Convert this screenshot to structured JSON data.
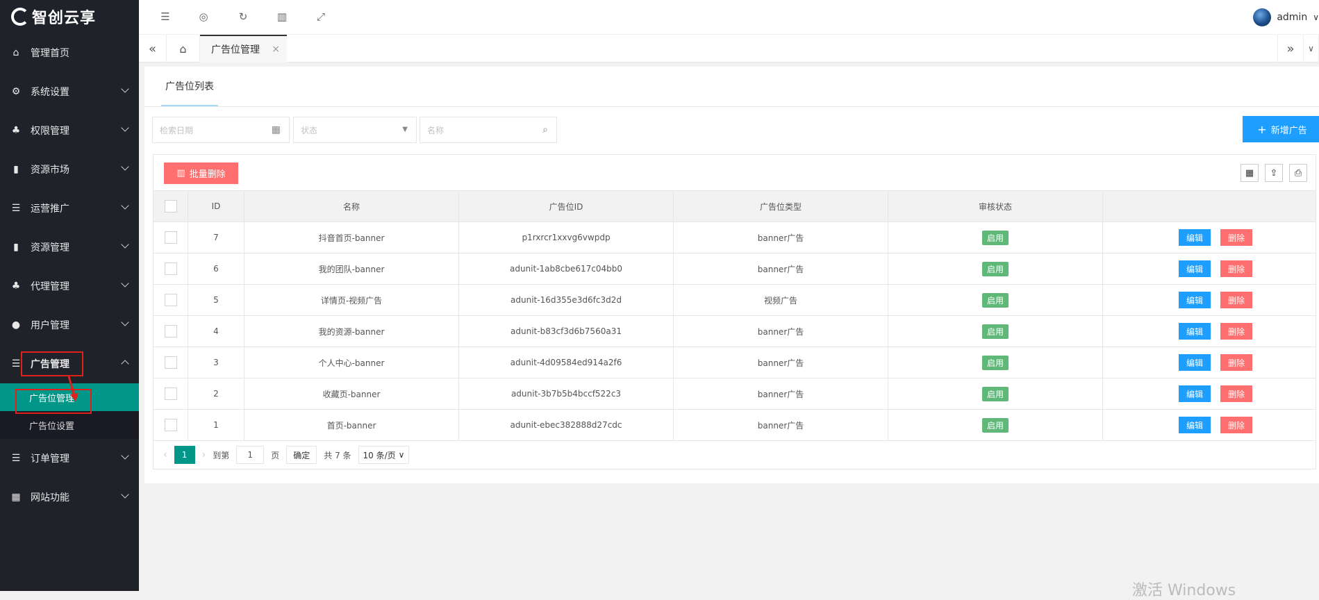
{
  "brand": {
    "logo_text": "智创云享"
  },
  "sidebar": {
    "items": [
      {
        "label": "管理首页",
        "icon": "home-icon",
        "glyph": "⌂"
      },
      {
        "label": "系统设置",
        "icon": "gear-icon",
        "glyph": "⚙"
      },
      {
        "label": "权限管理",
        "icon": "users-icon",
        "glyph": "♣"
      },
      {
        "label": "资源市场",
        "icon": "book-icon",
        "glyph": "▮"
      },
      {
        "label": "运营推广",
        "icon": "list-icon",
        "glyph": "☰"
      },
      {
        "label": "资源管理",
        "icon": "book-icon",
        "glyph": "▮"
      },
      {
        "label": "代理管理",
        "icon": "sitemap-icon",
        "glyph": "♣"
      },
      {
        "label": "用户管理",
        "icon": "user-icon",
        "glyph": "●"
      },
      {
        "label": "广告管理",
        "icon": "list-icon",
        "glyph": "☰"
      },
      {
        "label": "订单管理",
        "icon": "list-icon",
        "glyph": "☰"
      },
      {
        "label": "网站功能",
        "icon": "grid-icon",
        "glyph": "▦"
      }
    ],
    "sub_items": [
      {
        "label": "广告位管理"
      },
      {
        "label": "广告位设置"
      }
    ]
  },
  "topbar": {
    "icons": [
      "menu-collapse-icon",
      "globe-icon",
      "refresh-icon",
      "trash-icon",
      "fullscreen-icon"
    ],
    "username": "admin"
  },
  "tabs": {
    "active_label": "广告位管理",
    "close_glyph": "×"
  },
  "card": {
    "title": "广告位列表",
    "filters": {
      "date_placeholder": "检索日期",
      "status_placeholder": "状态",
      "name_placeholder": "名称"
    },
    "add_button": "新增广告",
    "batch_delete_button": "批量删除"
  },
  "table": {
    "columns": [
      "ID",
      "名称",
      "广告位ID",
      "广告位类型",
      "审核状态"
    ],
    "rows": [
      {
        "id": "7",
        "name": "抖音首页-banner",
        "ad_id": "p1rxrcr1xxvg6vwpdp",
        "type": "banner广告",
        "status": "启用"
      },
      {
        "id": "6",
        "name": "我的团队-banner",
        "ad_id": "adunit-1ab8cbe617c04bb0",
        "type": "banner广告",
        "status": "启用"
      },
      {
        "id": "5",
        "name": "详情页-视频广告",
        "ad_id": "adunit-16d355e3d6fc3d2d",
        "type": "视频广告",
        "status": "启用"
      },
      {
        "id": "4",
        "name": "我的资源-banner",
        "ad_id": "adunit-b83cf3d6b7560a31",
        "type": "banner广告",
        "status": "启用"
      },
      {
        "id": "3",
        "name": "个人中心-banner",
        "ad_id": "adunit-4d09584ed914a2f6",
        "type": "banner广告",
        "status": "启用"
      },
      {
        "id": "2",
        "name": "收藏页-banner",
        "ad_id": "adunit-3b7b5b4bccf522c3",
        "type": "banner广告",
        "status": "启用"
      },
      {
        "id": "1",
        "name": "首页-banner",
        "ad_id": "adunit-ebec382888d27cdc",
        "type": "banner广告",
        "status": "启用"
      }
    ],
    "edit_label": "编辑",
    "delete_label": "删除"
  },
  "pagination": {
    "current_page": "1",
    "goto_label": "到第",
    "goto_value": "1",
    "page_unit": "页",
    "confirm_label": "确定",
    "total_text": "共 7 条",
    "page_size": "10 条/页"
  },
  "watermark": "激活 Windows",
  "colors": {
    "sidebar_bg": "#20222a",
    "active_teal": "#009688",
    "primary_blue": "#1e9fff",
    "danger_red": "#ff6f6f",
    "success_green": "#5fb878",
    "highlight_red": "#e0201a"
  }
}
